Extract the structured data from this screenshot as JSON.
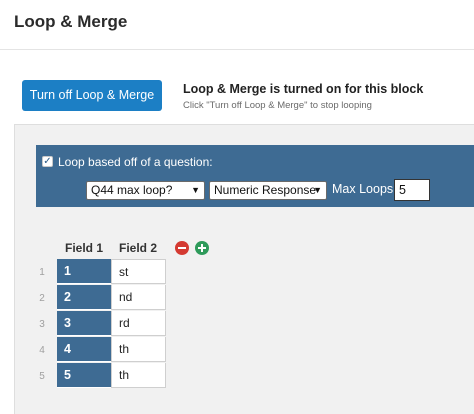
{
  "header": {
    "title": "Loop & Merge"
  },
  "loop_status": {
    "button_label": "Turn off Loop & Merge",
    "title": "Loop & Merge is turned on for this block",
    "hint": "Click \"Turn off Loop & Merge\" to stop looping"
  },
  "loop_config": {
    "checkbox_label": "Loop based off of a question:",
    "checked": true,
    "question_select": "Q44 max loop?",
    "type_select": "Numeric Response",
    "max_loops_label": "Max Loops:",
    "max_loops_value": "5"
  },
  "table": {
    "headers": [
      "Field 1",
      "Field 2"
    ],
    "rows": [
      {
        "num": "1",
        "field1": "1",
        "field2": "st"
      },
      {
        "num": "2",
        "field1": "2",
        "field2": "nd"
      },
      {
        "num": "3",
        "field1": "3",
        "field2": "rd"
      },
      {
        "num": "4",
        "field1": "4",
        "field2": "th"
      },
      {
        "num": "5",
        "field1": "5",
        "field2": "th"
      }
    ]
  },
  "icons": {
    "remove_column": "minus-circle-icon",
    "add_column": "plus-circle-icon",
    "check": "checkmark-icon",
    "chevron": "chevron-down-icon"
  },
  "colors": {
    "primary_button": "#1c7fc5",
    "loop_bar": "#3e6b93",
    "remove": "#d43a32",
    "add": "#2e9a5a"
  }
}
